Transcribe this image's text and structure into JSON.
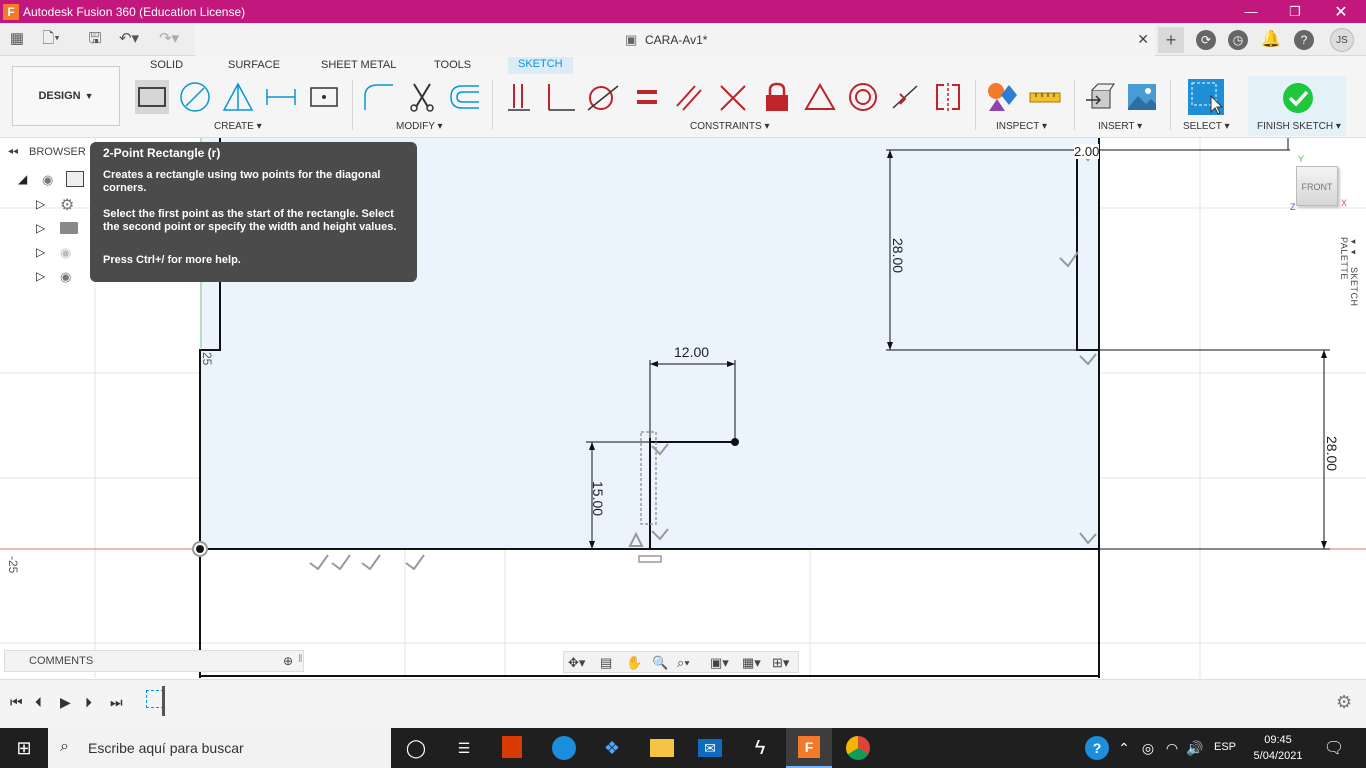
{
  "window": {
    "title": "Autodesk Fusion 360 (Education License)",
    "logo_letter": "F",
    "doc_name": "CARA-Av1*",
    "user_initials": "JS"
  },
  "toolbar": {
    "workspace": "DESIGN",
    "tabs": [
      "SOLID",
      "SURFACE",
      "SHEET METAL",
      "TOOLS",
      "SKETCH"
    ],
    "active_tab": "SKETCH",
    "groups": {
      "create": "CREATE",
      "modify": "MODIFY",
      "constraints": "CONSTRAINTS",
      "inspect": "INSPECT",
      "insert": "INSERT",
      "select": "SELECT",
      "finish": "FINISH SKETCH"
    }
  },
  "browser": {
    "label": "BROWSER"
  },
  "tooltip": {
    "title": "2-Point Rectangle (r)",
    "line1": "Creates a rectangle using two points for the diagonal corners.",
    "line2": "Select the first point as the start of the rectangle. Select the second point or specify the width and height values.",
    "line3": "Press Ctrl+/ for more help."
  },
  "sketch": {
    "dim_top": "2.00",
    "dim_28_left": "28.00",
    "dim_28_right": "28.00",
    "dim_12": "12.00",
    "dim_15": "15.00",
    "axis_y_label": "25",
    "axis_x_label": "-25"
  },
  "viewcube": {
    "face": "FRONT",
    "axis_y": "Y",
    "axis_x": "X",
    "axis_z": "Z"
  },
  "side_panel": {
    "sketch_palette": "SKETCH PALETTE"
  },
  "comments": {
    "label": "COMMENTS"
  },
  "taskbar": {
    "search_placeholder": "Escribe aquí para buscar",
    "language": "ESP",
    "time": "09:45",
    "date": "5/04/2021"
  },
  "colors": {
    "title_bar": "#c2187e",
    "accent": "#0696d7",
    "finish_check": "#1ec73c"
  }
}
